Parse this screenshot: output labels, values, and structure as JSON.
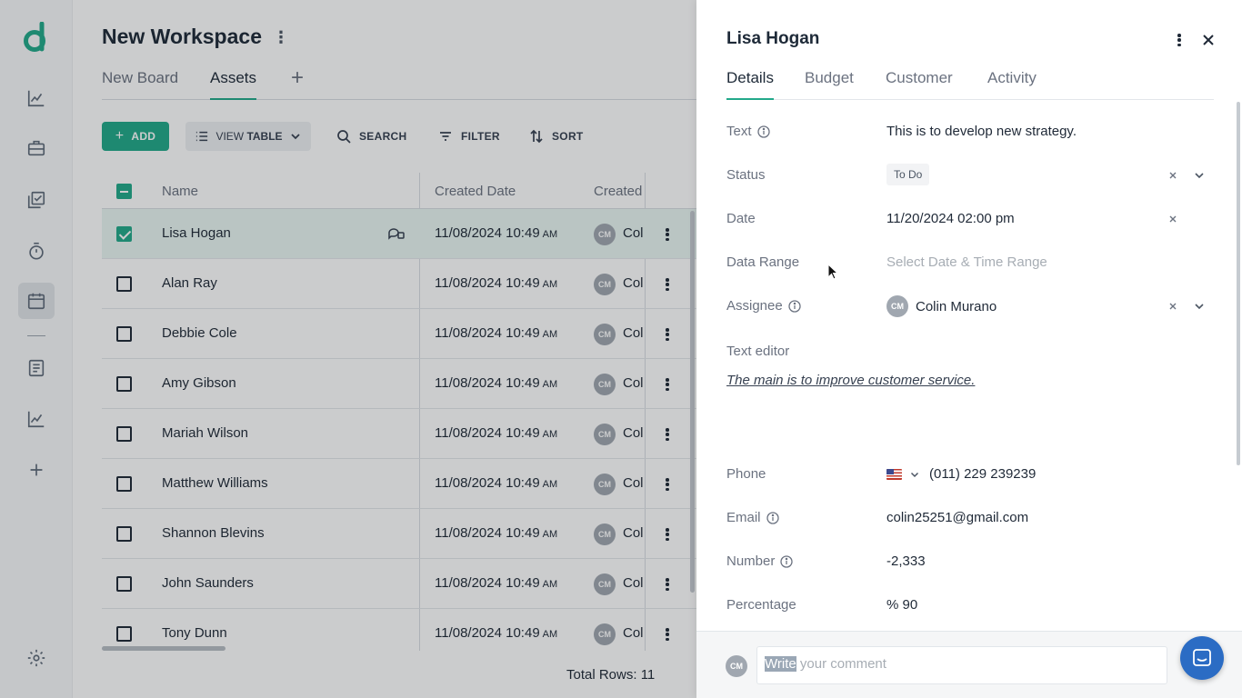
{
  "app": {
    "brand_color": "#22a98a"
  },
  "rail": {
    "items": [
      "trend-icon",
      "briefcase-icon",
      "checklist-icon",
      "timer-icon",
      "calendar-icon",
      "document-icon",
      "chart-icon",
      "plus-icon"
    ],
    "settings": "gear-icon"
  },
  "workspace": {
    "title": "New Workspace",
    "tabs": [
      {
        "label": "New Board"
      },
      {
        "label": "Assets"
      }
    ],
    "add_tab": "+"
  },
  "toolbar": {
    "add_label": "ADD",
    "view_label_prefix": "VIEW",
    "view_label_strong": "TABLE",
    "search_label": "SEARCH",
    "filter_label": "FILTER",
    "sort_label": "SORT"
  },
  "table": {
    "columns": [
      "Name",
      "Created Date",
      "Created"
    ],
    "rows": [
      {
        "name": "Lisa Hogan",
        "date": "11/08/2024 10:49",
        "ampm": "AM",
        "avatar": "CM",
        "created_by": "Col"
      },
      {
        "name": "Alan Ray",
        "date": "11/08/2024 10:49",
        "ampm": "AM",
        "avatar": "CM",
        "created_by": "Col"
      },
      {
        "name": "Debbie Cole",
        "date": "11/08/2024 10:49",
        "ampm": "AM",
        "avatar": "CM",
        "created_by": "Col"
      },
      {
        "name": "Amy Gibson",
        "date": "11/08/2024 10:49",
        "ampm": "AM",
        "avatar": "CM",
        "created_by": "Col"
      },
      {
        "name": "Mariah Wilson",
        "date": "11/08/2024 10:49",
        "ampm": "AM",
        "avatar": "CM",
        "created_by": "Col"
      },
      {
        "name": "Matthew Williams",
        "date": "11/08/2024 10:49",
        "ampm": "AM",
        "avatar": "CM",
        "created_by": "Col"
      },
      {
        "name": "Shannon Blevins",
        "date": "11/08/2024 10:49",
        "ampm": "AM",
        "avatar": "CM",
        "created_by": "Col"
      },
      {
        "name": "John Saunders",
        "date": "11/08/2024 10:49",
        "ampm": "AM",
        "avatar": "CM",
        "created_by": "Col"
      },
      {
        "name": "Tony Dunn",
        "date": "11/08/2024 10:49",
        "ampm": "AM",
        "avatar": "CM",
        "created_by": "Col"
      }
    ],
    "total_rows": "Total Rows: 11"
  },
  "panel": {
    "title": "Lisa Hogan",
    "tabs": [
      {
        "label": "Details"
      },
      {
        "label": "Budget"
      },
      {
        "label": "Customer"
      },
      {
        "label": "Activity"
      }
    ],
    "fields": {
      "text": {
        "label": "Text",
        "value": "This is to develop new strategy."
      },
      "status": {
        "label": "Status",
        "value": "To Do"
      },
      "date": {
        "label": "Date",
        "value": "11/20/2024 02:00 pm"
      },
      "range": {
        "label": "Data Range",
        "placeholder": "Select Date & Time Range"
      },
      "assignee": {
        "label": "Assignee",
        "avatar": "CM",
        "value": "Colin Murano"
      },
      "editor": {
        "label": "Text editor",
        "value": "The main is to improve customer service."
      },
      "phone": {
        "label": "Phone",
        "value": "(011) 229 239239"
      },
      "email": {
        "label": "Email",
        "value": "colin25251@gmail.com"
      },
      "number": {
        "label": "Number",
        "value": "-2,333"
      },
      "percentage": {
        "label": "Percentage",
        "value": "% 90"
      }
    },
    "comment": {
      "avatar": "CM",
      "highlight": "Write",
      "rest": " your comment"
    }
  }
}
